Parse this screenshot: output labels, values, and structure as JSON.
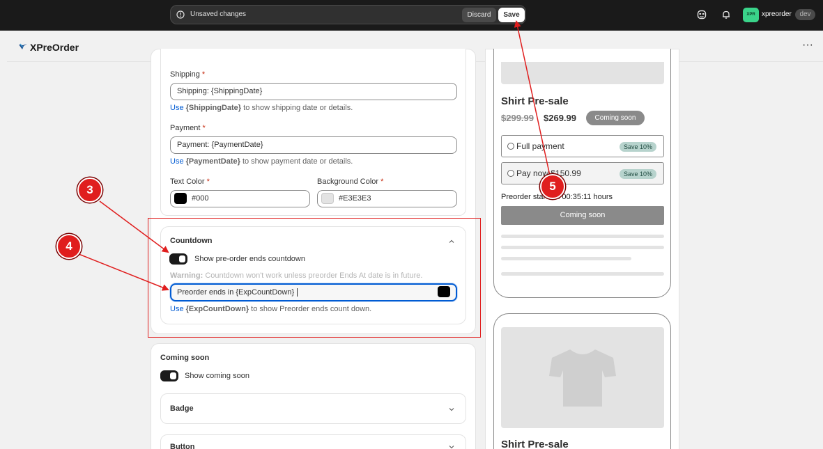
{
  "topbar": {
    "unsaved_text": "Unsaved changes",
    "discard_label": "Discard",
    "save_label": "Save",
    "avatar_text": "XPR",
    "store_name": "xpreorder",
    "env_badge": "dev"
  },
  "app": {
    "title": "XPreOrder"
  },
  "shipping": {
    "label": "Shipping",
    "value": "Shipping: {ShippingDate}",
    "help_use": "Use",
    "help_token": "{ShippingDate}",
    "help_rest": "to show shipping date or details."
  },
  "payment": {
    "label": "Payment",
    "value": "Payment: {PaymentDate}",
    "help_use": "Use",
    "help_token": "{PaymentDate}",
    "help_rest": "to show payment date or details."
  },
  "colors_row": {
    "text_color_label": "Text Color",
    "text_color_value": "#000",
    "bg_color_label": "Background Color",
    "bg_color_value": "#E3E3E3"
  },
  "required_mark": "*",
  "countdown": {
    "title": "Countdown",
    "toggle_label": "Show pre-order ends countdown",
    "warning_strong": "Warning:",
    "warning_text": "Countdown won't work unless preorder Ends At date is in future.",
    "input_value": "Preorder ends in {ExpCountDown}",
    "help_use": "Use",
    "help_token": "{ExpCountDown}",
    "help_rest": "to show Preorder ends count down."
  },
  "coming_soon": {
    "title": "Coming soon",
    "toggle_label": "Show coming soon",
    "badge_label": "Badge",
    "button_label": "Button"
  },
  "preview": {
    "product_title": "Shirt Pre-sale",
    "old_price": "$299.99",
    "new_price": "$269.99",
    "coming_soon_pill": "Coming soon",
    "option_full": "Full payment",
    "option_partial": "Pay now $150.99",
    "save_badge": "Save 10%",
    "preorder_status": "Preorder starts in 00:35:11 hours",
    "coming_soon_button": "Coming soon",
    "product_title_2": "Shirt Pre-sale"
  },
  "annotations": {
    "a3": "3",
    "a4": "4",
    "a5": "5"
  },
  "colors": {
    "accent_link": "#005bd3",
    "annotation_red": "#e01e1e",
    "topbar_bg": "#1a1a1a"
  },
  "icons": [
    "info-icon",
    "discard-save",
    "face-icon",
    "bell-icon",
    "logo-icon",
    "more-icon",
    "chevron-up-icon",
    "chevron-down-icon",
    "tshirt-icon"
  ]
}
